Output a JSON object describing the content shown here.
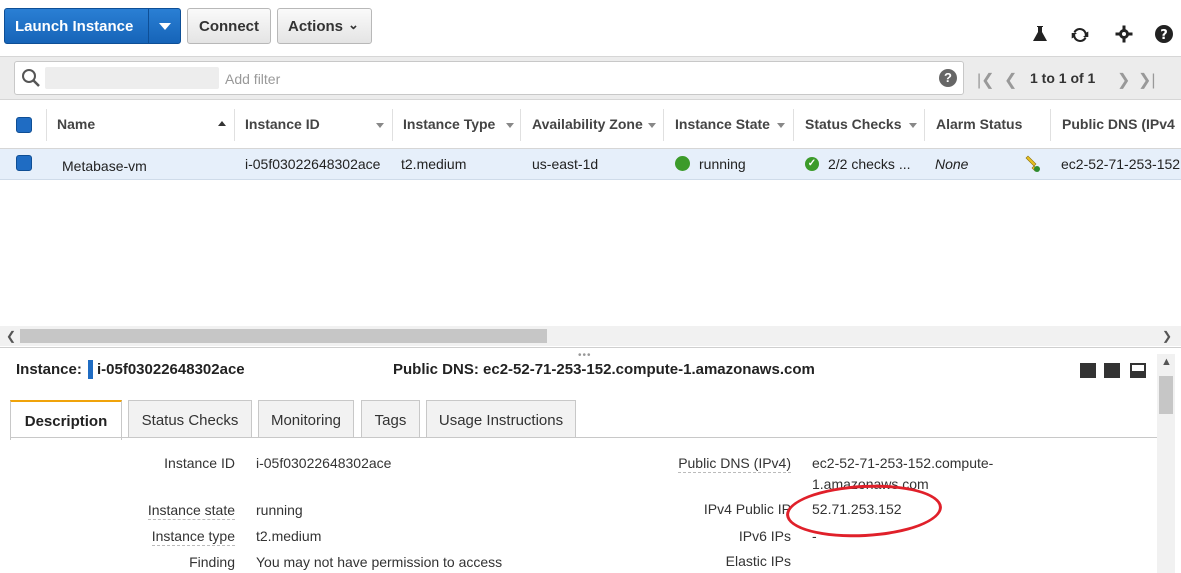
{
  "toolbar": {
    "launch_label": "Launch Instance",
    "connect_label": "Connect",
    "actions_label": "Actions",
    "icons": [
      "flask-icon",
      "refresh-icon",
      "gear-icon",
      "help-icon"
    ]
  },
  "filter": {
    "placeholder": "Add filter",
    "pagination": "1 to 1 of 1"
  },
  "table": {
    "columns": [
      "Name",
      "Instance ID",
      "Instance Type",
      "Availability Zone",
      "Instance State",
      "Status Checks",
      "Alarm Status",
      "Public DNS (IPv4"
    ],
    "rows": [
      {
        "name": "Metabase-vm",
        "instance_id": "i-05f03022648302ace",
        "instance_type": "t2.medium",
        "availability_zone": "us-east-1d",
        "instance_state": "running",
        "status_checks": "2/2 checks ...",
        "alarm_status": "None",
        "public_dns": "ec2-52-71-253-152"
      }
    ]
  },
  "detail": {
    "instance_label": "Instance:",
    "instance_id": "i-05f03022648302ace",
    "public_dns_header": "Public DNS: ec2-52-71-253-152.compute-1.amazonaws.com",
    "tabs": [
      "Description",
      "Status Checks",
      "Monitoring",
      "Tags",
      "Usage Instructions"
    ],
    "active_tab": "Description",
    "left_fields": [
      {
        "label": "Instance ID",
        "value": "i-05f03022648302ace"
      },
      {
        "label": "Instance state",
        "value": "running"
      },
      {
        "label": "Instance type",
        "value": "t2.medium"
      },
      {
        "label": "Finding",
        "value": "You may not have permission to access"
      }
    ],
    "right_fields": [
      {
        "label": "Public DNS (IPv4)",
        "value": "ec2-52-71-253-152.compute-",
        "value2": "1.amazonaws.com"
      },
      {
        "label": "IPv4 Public IP",
        "value": "52.71.253.152"
      },
      {
        "label": "IPv6 IPs",
        "value": "-"
      },
      {
        "label": "Elastic IPs",
        "value": ""
      }
    ]
  },
  "colors": {
    "primary_button": "#1f6cc3",
    "running_green": "#3c9b2a",
    "active_tab_accent": "#f0a30a",
    "annotation_red": "#e0202a"
  }
}
